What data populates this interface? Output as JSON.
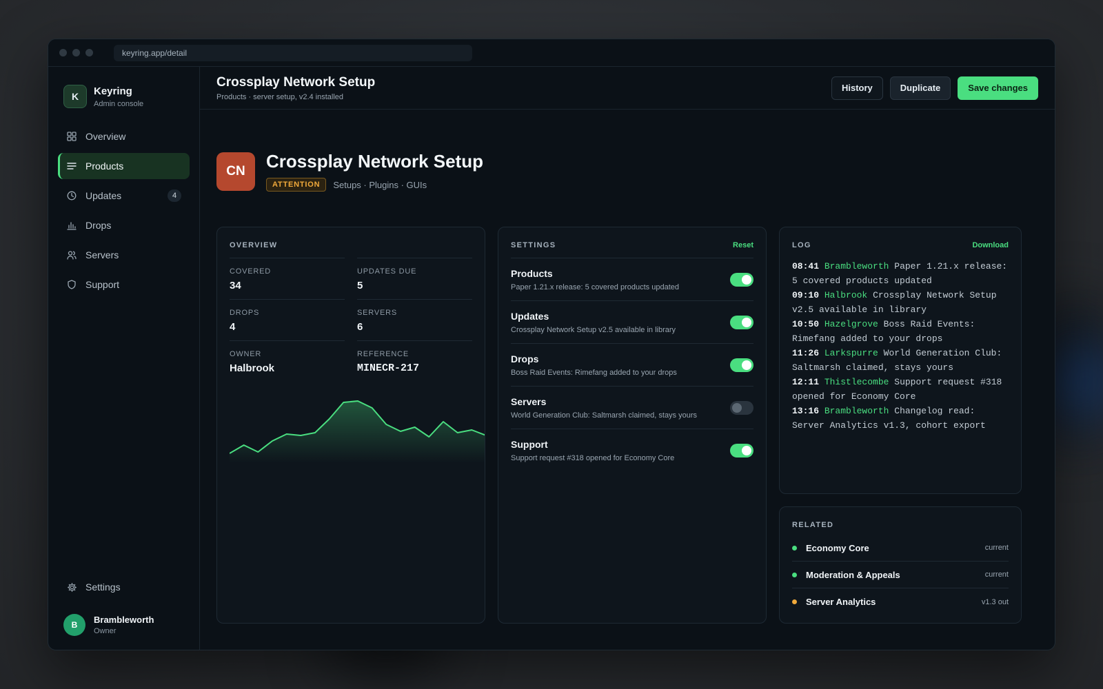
{
  "browser": {
    "url": "keyring.app/detail"
  },
  "brand": {
    "logo": "K",
    "name": "Keyring",
    "subtitle": "Admin console"
  },
  "sidebar": {
    "items": [
      {
        "label": "Overview",
        "icon": "grid-icon"
      },
      {
        "label": "Products",
        "icon": "list-icon",
        "active": true
      },
      {
        "label": "Updates",
        "icon": "clock-icon",
        "badge": "4"
      },
      {
        "label": "Drops",
        "icon": "bar-chart-icon"
      },
      {
        "label": "Servers",
        "icon": "users-icon"
      },
      {
        "label": "Support",
        "icon": "shield-icon"
      }
    ],
    "settings_label": "Settings"
  },
  "user": {
    "initial": "B",
    "name": "Brambleworth",
    "role": "Owner"
  },
  "topbar": {
    "title": "Crossplay Network Setup",
    "subtitle": "Products · server setup, v2.4 installed",
    "history_label": "History",
    "duplicate_label": "Duplicate",
    "save_label": "Save changes"
  },
  "hero": {
    "logo": "CN",
    "title": "Crossplay Network Setup",
    "badge": "ATTENTION",
    "tags": "Setups · Plugins · GUIs"
  },
  "overview": {
    "heading": "OVERVIEW",
    "cells": [
      {
        "label": "COVERED",
        "value": "34"
      },
      {
        "label": "UPDATES DUE",
        "value": "5"
      },
      {
        "label": "DROPS",
        "value": "4"
      },
      {
        "label": "SERVERS",
        "value": "6"
      },
      {
        "label": "OWNER",
        "value": "Halbrook"
      },
      {
        "label": "REFERENCE",
        "value": "MINECR-217"
      }
    ]
  },
  "chart_data": {
    "type": "area",
    "values": [
      4,
      10,
      5,
      13,
      18,
      17,
      19,
      29,
      41,
      42,
      37,
      25,
      20,
      23,
      16,
      27,
      19,
      21,
      17
    ],
    "ylim": [
      0,
      50
    ],
    "color": "#4ade80"
  },
  "settings": {
    "heading": "SETTINGS",
    "reset_label": "Reset",
    "rows": [
      {
        "title": "Products",
        "desc": "Paper 1.21.x release: 5 covered products updated",
        "on": true
      },
      {
        "title": "Updates",
        "desc": "Crossplay Network Setup v2.5 available in library",
        "on": true
      },
      {
        "title": "Drops",
        "desc": "Boss Raid Events: Rimefang added to your drops",
        "on": true
      },
      {
        "title": "Servers",
        "desc": "World Generation Club: Saltmarsh claimed, stays yours",
        "on": false
      },
      {
        "title": "Support",
        "desc": "Support request #318 opened for Economy Core",
        "on": true
      }
    ]
  },
  "log": {
    "heading": "LOG",
    "download_label": "Download",
    "entries": [
      {
        "time": "08:41",
        "user": "Brambleworth",
        "text": "Paper 1.21.x release: 5 covered products updated"
      },
      {
        "time": "09:10",
        "user": "Halbrook",
        "text": "Crossplay Network Setup v2.5 available in library"
      },
      {
        "time": "10:50",
        "user": "Hazelgrove",
        "text": "Boss Raid Events: Rimefang added to your drops"
      },
      {
        "time": "11:26",
        "user": "Larkspurre",
        "text": "World Generation Club: Saltmarsh claimed, stays yours"
      },
      {
        "time": "12:11",
        "user": "Thistlecombe",
        "text": "Support request #318 opened for Economy Core"
      },
      {
        "time": "13:16",
        "user": "Brambleworth",
        "text": "Changelog read: Server Analytics v1.3, cohort export"
      }
    ]
  },
  "related": {
    "heading": "RELATED",
    "items": [
      {
        "name": "Economy Core",
        "status": "current",
        "color": "#4ade80"
      },
      {
        "name": "Moderation & Appeals",
        "status": "current",
        "color": "#4ade80"
      },
      {
        "name": "Server Analytics",
        "status": "v1.3 out",
        "color": "#f0a93b"
      }
    ]
  },
  "colors": {
    "accent": "#4ade80",
    "warning": "#f0a93b",
    "hero_logo": "#b5482e"
  }
}
